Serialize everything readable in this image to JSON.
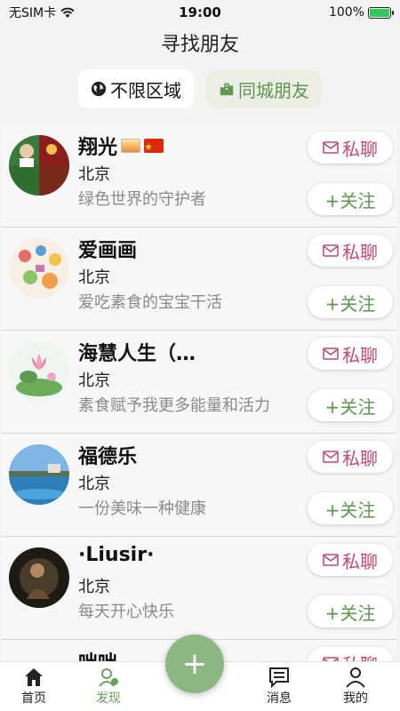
{
  "status": {
    "carrier": "无SIM卡",
    "time": "19:00",
    "battery": "100%"
  },
  "header": {
    "title": "寻找朋友"
  },
  "filters": [
    {
      "label": "不限区域",
      "icon": "globe-icon",
      "active": false
    },
    {
      "label": "同城朋友",
      "icon": "city-icon",
      "active": true
    }
  ],
  "buttons": {
    "chat": "私聊",
    "follow": "+关注"
  },
  "friends": [
    {
      "name": "翔光",
      "city": "北京",
      "signature": "绿色世界的守护者",
      "badges": [
        "sun-badge-icon",
        "china-flag-icon"
      ]
    },
    {
      "name": "爱画画",
      "city": "北京",
      "signature": "爱吃素食的宝宝干活"
    },
    {
      "name": "海慧人生（…",
      "city": "北京",
      "signature": "素食赋予我更多能量和活力"
    },
    {
      "name": "福德乐",
      "city": "北京",
      "signature": "一份美味一种健康"
    },
    {
      "name": "·Liusir·",
      "city": "北京",
      "signature": "每天开心快乐"
    },
    {
      "name": "咄咄",
      "city": "",
      "signature": ""
    }
  ],
  "tabs": [
    {
      "label": "首页",
      "icon": "home-icon"
    },
    {
      "label": "发现",
      "icon": "discover-icon",
      "active": true
    },
    {
      "label": "消息",
      "icon": "message-icon"
    },
    {
      "label": "我的",
      "icon": "profile-icon"
    }
  ],
  "fab": {
    "label": "+"
  },
  "colors": {
    "accent_green": "#5d9650",
    "chat_pink": "#c0496e",
    "fab_green": "#8db685"
  }
}
